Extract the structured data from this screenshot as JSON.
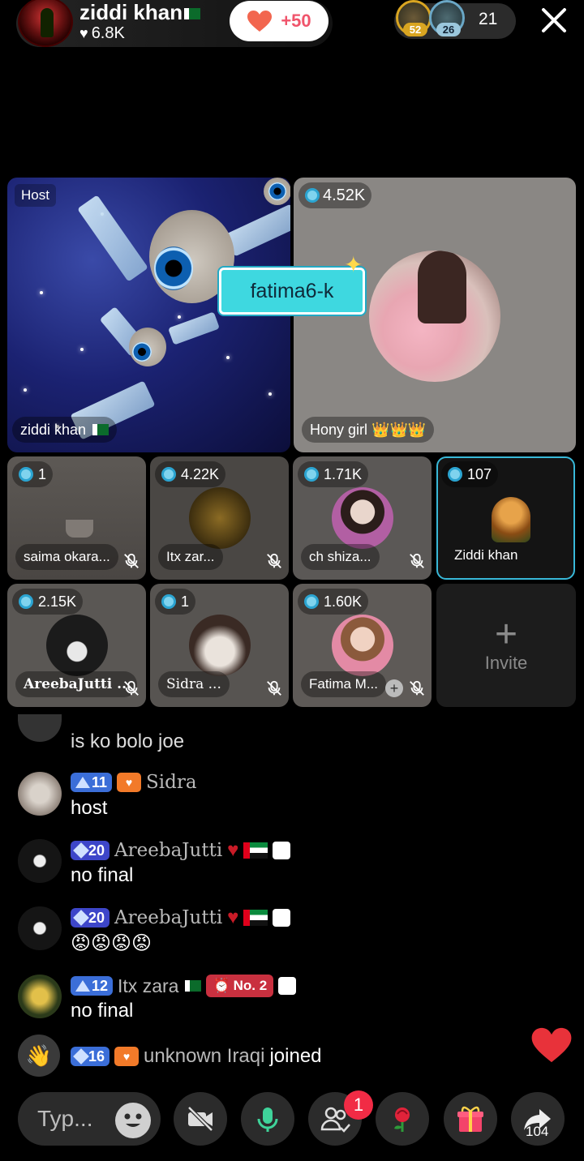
{
  "header": {
    "host_name": "ziddi khan",
    "host_likes": "6.8K",
    "like_increment": "+50",
    "viewer_badges": [
      "52",
      "26"
    ],
    "viewer_count": "21"
  },
  "main_grid": {
    "host_tile": {
      "tag": "Host",
      "name": "ziddi khan"
    },
    "guest_tile": {
      "score": "4.52K",
      "name": "Hony girl 👑👑👑"
    },
    "name_tag": "fatima6-k"
  },
  "seats": [
    {
      "score": "1",
      "name": "saima okara..."
    },
    {
      "score": "4.22K",
      "name": "Itx zar..."
    },
    {
      "score": "1.71K",
      "name": "ch shiza..."
    },
    {
      "score": "107",
      "name": "Ziddi khan"
    },
    {
      "score": "2.15K",
      "name": "AreebaJutti ..."
    },
    {
      "score": "1",
      "name": "Sidra ..."
    },
    {
      "score": "1.60K",
      "name": "Fatima M..."
    }
  ],
  "invite": {
    "label": "Invite",
    "plus": "+"
  },
  "chat": [
    {
      "user": "",
      "text": "is ko bolo joe"
    },
    {
      "level": "11",
      "user": "Sidra",
      "text": "host"
    },
    {
      "level": "20",
      "user": "AreebaJutti",
      "text": "no final"
    },
    {
      "level": "20",
      "user": "AreebaJutti",
      "text": "😡😡😡😡"
    },
    {
      "level": "12",
      "user": "Itx zara",
      "rank": "No. 2",
      "text": "no final"
    },
    {
      "level": "16",
      "user": "unknown Iraqi",
      "text": "joined"
    }
  ],
  "bottom": {
    "type_placeholder": "Typ...",
    "notif_count": "1",
    "share_count": "104"
  },
  "colors": {
    "accent": "#3ed8e0",
    "like": "#f0546b",
    "level": "#3b6ed8"
  }
}
